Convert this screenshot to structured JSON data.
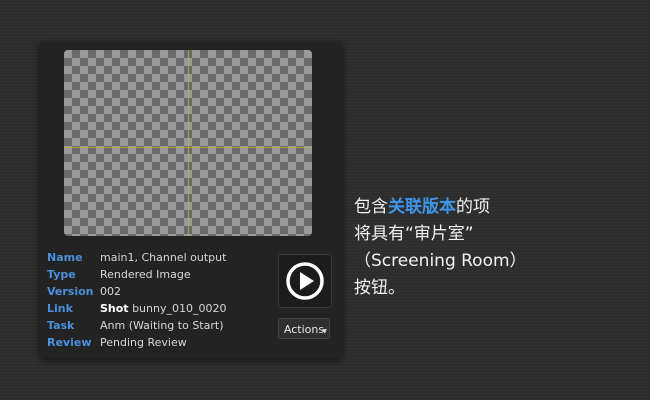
{
  "panel": {
    "fields": [
      {
        "key": "Name",
        "value": "main1, Channel output"
      },
      {
        "key": "Type",
        "value": "Rendered Image"
      },
      {
        "key": "Version",
        "value": "002"
      },
      {
        "key": "Link",
        "value_bold": "Shot",
        "value": " bunny_010_0020"
      },
      {
        "key": "Task",
        "value": "Anm (Waiting to Start)"
      },
      {
        "key": "Review",
        "value": "Pending Review"
      }
    ],
    "actions_label": "Actions"
  },
  "callout": {
    "line1_pre": "包含",
    "line1_highlight": "关联版本",
    "line1_post": "的项",
    "line2": "将具有“审片室”",
    "line3": "（Screening Room）",
    "line4": "按钮。"
  },
  "colors": {
    "accent": "#3d96ea",
    "label_blue": "#4a8fdc",
    "guide_yellow": "#b7ae3c"
  }
}
